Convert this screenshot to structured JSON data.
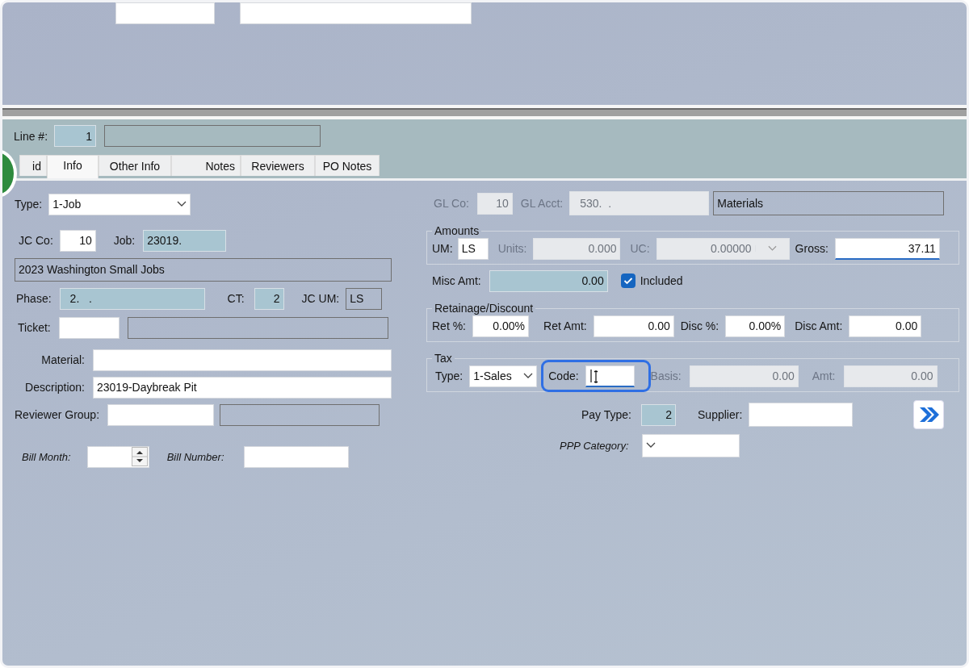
{
  "line": {
    "label": "Line #:",
    "value": "1"
  },
  "tabs": [
    {
      "label": "id",
      "selected": false
    },
    {
      "label": "Info",
      "selected": true
    },
    {
      "label": "Other Info",
      "selected": false
    },
    {
      "label": "Notes",
      "selected": false
    },
    {
      "label": "Reviewers",
      "selected": false
    },
    {
      "label": "PO Notes",
      "selected": false
    }
  ],
  "type": {
    "label": "Type:",
    "value": "1-Job"
  },
  "jc_co": {
    "label": "JC Co:",
    "value": "10"
  },
  "job": {
    "label": "Job:",
    "value": "23019."
  },
  "job_description": "2023 Washington Small Jobs",
  "phase": {
    "label": "Phase:",
    "value": "2.   ."
  },
  "ct": {
    "label": "CT:",
    "value": "2"
  },
  "jc_um": {
    "label": "JC UM:",
    "value": "LS"
  },
  "ticket": {
    "label": "Ticket:"
  },
  "material": {
    "label": "Material:"
  },
  "description": {
    "label": "Description:",
    "value": "23019-Daybreak Pit"
  },
  "reviewer_group": {
    "label": "Reviewer Group:"
  },
  "bill_month": {
    "label": "Bill Month:"
  },
  "bill_number": {
    "label": "Bill Number:"
  },
  "gl_co": {
    "label": "GL Co:",
    "value": "10",
    "disabled": true
  },
  "gl_acct": {
    "label": "GL Acct:",
    "value": "530.  .",
    "disabled": true
  },
  "gl_description": "Materials",
  "amounts": {
    "title": "Amounts",
    "um": {
      "label": "UM:",
      "value": "LS"
    },
    "units": {
      "label": "Units:",
      "value": "0.000",
      "disabled": true
    },
    "uc": {
      "label": "UC:",
      "value": "0.00000",
      "disabled": true
    },
    "gross": {
      "label": "Gross:",
      "value": "37.11"
    }
  },
  "misc_amt": {
    "label": "Misc Amt:",
    "value": "0.00"
  },
  "included": {
    "label": "Included",
    "checked": true
  },
  "retainage": {
    "title": "Retainage/Discount",
    "fields": [
      {
        "label": "Ret %:",
        "value": "0.00%"
      },
      {
        "label": "Ret Amt:",
        "value": "0.00"
      },
      {
        "label": "Disc %:",
        "value": "0.00%"
      },
      {
        "label": "Disc Amt:",
        "value": "0.00"
      }
    ]
  },
  "tax": {
    "title": "Tax",
    "type": {
      "label": "Type:",
      "value": "1-Sales"
    },
    "code": {
      "label": "Code:",
      "highlighted": true
    },
    "basis": {
      "label": "Basis:",
      "value": "0.00",
      "disabled": true
    },
    "amt": {
      "label": "Amt:",
      "value": "0.00",
      "disabled": true
    }
  },
  "pay_type": {
    "label": "Pay Type:",
    "value": "2"
  },
  "supplier": {
    "label": "Supplier:"
  },
  "ppp_category": {
    "label": "PPP Category:"
  }
}
